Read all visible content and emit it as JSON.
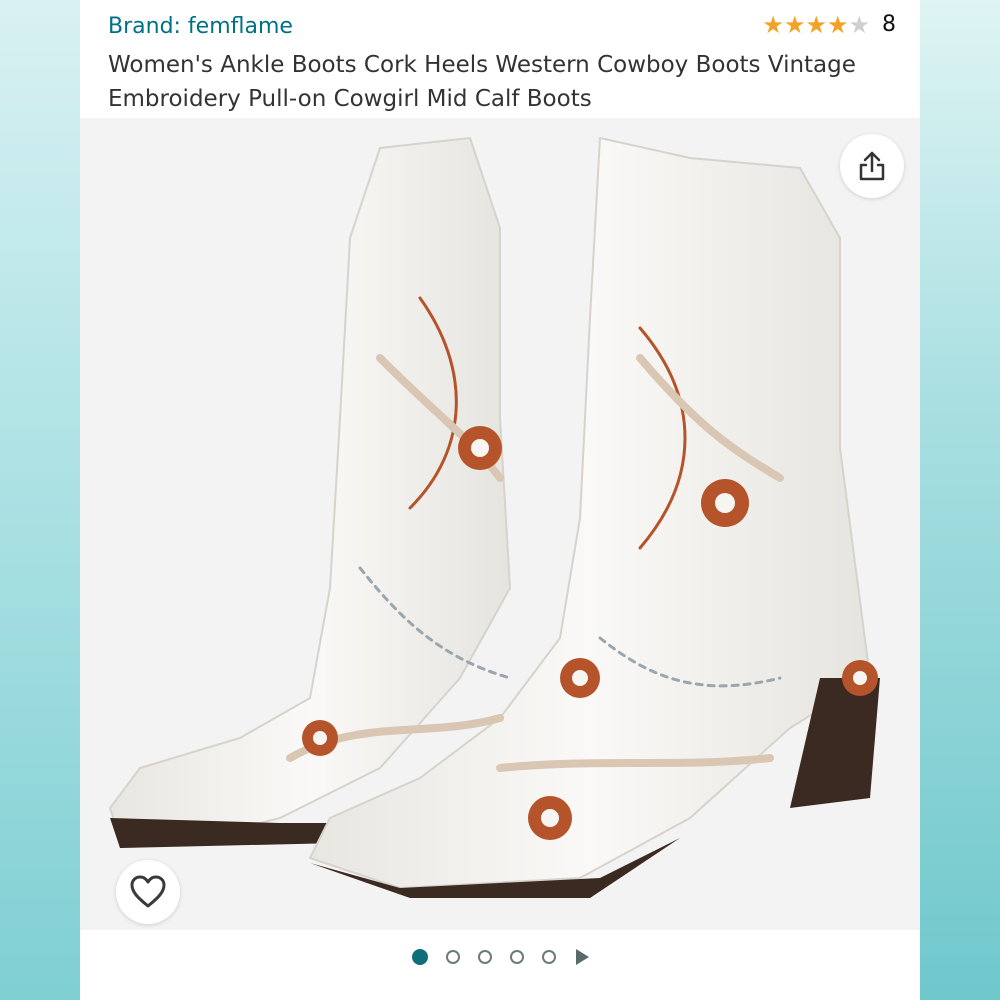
{
  "product": {
    "brand_label": "Brand: femflame",
    "title": "Women's Ankle Boots Cork Heels Western Cowboy Boots Vintage Embroidery Pull-on Cowgirl Mid Calf Boots",
    "rating": 4,
    "rating_max": 5,
    "rating_count": "8"
  },
  "gallery": {
    "image_count": 5,
    "active_index": 1,
    "share_icon": "share-icon",
    "wishlist_icon": "heart-icon",
    "next_icon": "play-triangle-icon"
  },
  "colors": {
    "brand_link": "#007185",
    "star_fill": "#f2a325",
    "active_dot": "#0e6f7a",
    "boot_white": "#f6f5f2",
    "embroidery_rust": "#b5532a",
    "embroidery_gray": "#9aa6ad",
    "heel_brown": "#3b2a22"
  }
}
